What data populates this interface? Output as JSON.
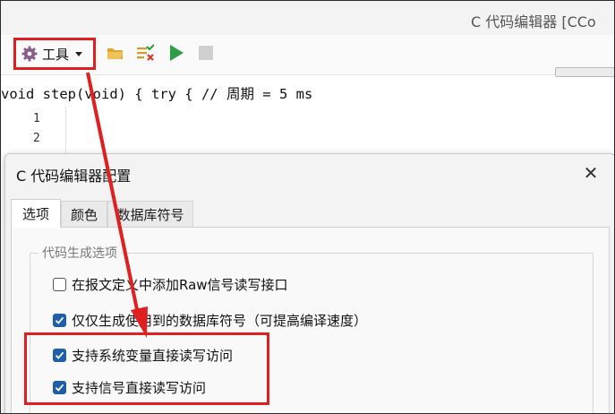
{
  "window": {
    "title": "C 代码编辑器 [CCo"
  },
  "toolbar": {
    "tools_label": "工具",
    "icons": [
      "gear-icon",
      "folder-open-icon",
      "edit-check-icon",
      "run-icon",
      "stop-icon"
    ]
  },
  "editor": {
    "code_line": "void step(void) { try { // 周期 = 5 ms",
    "line_numbers": [
      "1",
      "2"
    ]
  },
  "dialog": {
    "title": "C 代码编辑器配置",
    "close_glyph": "✕",
    "tabs": [
      {
        "label": "选项",
        "active": true
      },
      {
        "label": "颜色",
        "active": false
      },
      {
        "label": "数据库符号",
        "active": false
      }
    ],
    "group": {
      "legend": "代码生成选项",
      "options": [
        {
          "label": "在报文定义中添加Raw信号读写接口",
          "checked": false
        },
        {
          "label": "仅仅生成使用到的数据库符号（可提高编译速度）",
          "checked": true
        },
        {
          "label": "支持系统变量直接读写访问",
          "checked": true
        },
        {
          "label": "支持信号直接读写访问",
          "checked": true
        }
      ]
    }
  },
  "colors": {
    "highlight": "#e02020",
    "checkbox_checked": "#1f5fa8",
    "run_green": "#2e9e44",
    "folder_yellow": "#e0a72e"
  }
}
